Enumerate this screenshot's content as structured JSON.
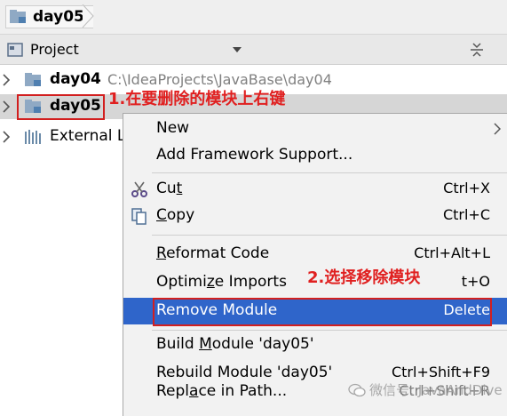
{
  "breadcrumb": {
    "label": "day05"
  },
  "project_panel": {
    "title": "Project"
  },
  "tree": {
    "rows": [
      {
        "name": "day04",
        "path": "C:\\IdeaProjects\\JavaBase\\day04"
      },
      {
        "name": "day05",
        "path": ""
      },
      {
        "name": "External L",
        "path": ""
      }
    ]
  },
  "annotations": {
    "step1": "1.在要删除的模块上右键",
    "step2": "2.选择移除模块"
  },
  "menu": {
    "new": "New",
    "add_framework": "Add Framework Support...",
    "cut_pre": "Cu",
    "cut_mn": "t",
    "cut_shortcut": "Ctrl+X",
    "copy_mn": "C",
    "copy_post": "opy",
    "copy_shortcut": "Ctrl+C",
    "reformat_mn": "R",
    "reformat_post": "eformat Code",
    "reformat_shortcut": "Ctrl+Alt+L",
    "optimize_pre": "Optimi",
    "optimize_mn": "z",
    "optimize_post": "e Imports",
    "optimize_shortcut": "t+O",
    "remove_module": "Remove Module",
    "remove_shortcut": "Delete",
    "build_pre": "Build ",
    "build_mn": "M",
    "build_post": "odule 'day05'",
    "rebuild": "Rebuild Module 'day05'",
    "rebuild_shortcut": "Ctrl+Shift+F9",
    "replace_pre": "Repl",
    "replace_mn": "a",
    "replace_post": "ce in Path...",
    "replace_shortcut": "Ctrl+Shift+R"
  },
  "watermark": {
    "text": "微信号: JavaAndDive"
  },
  "colors": {
    "selection": "#2f65ca",
    "annotation": "#e02020",
    "menu_bg": "#f2f2f2"
  }
}
